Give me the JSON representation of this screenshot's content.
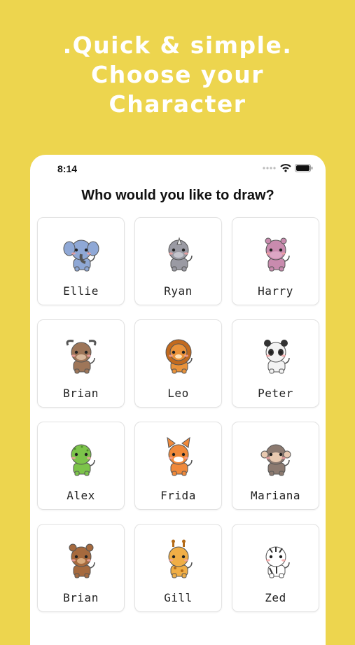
{
  "headline": {
    "line1": ".Quick & simple.",
    "line2": "Choose your",
    "line3": "Character"
  },
  "status_bar": {
    "time": "8:14"
  },
  "prompt": "Who would you like to draw?",
  "characters": [
    {
      "name": "Ellie",
      "animal": "elephant-icon",
      "color": "#8FA8D6"
    },
    {
      "name": "Ryan",
      "animal": "rhino-icon",
      "color": "#9A9AA3"
    },
    {
      "name": "Harry",
      "animal": "hippo-icon",
      "color": "#C98BAE"
    },
    {
      "name": "Brian",
      "animal": "buffalo-icon",
      "color": "#9E7659"
    },
    {
      "name": "Leo",
      "animal": "lion-icon",
      "color": "#E9923A"
    },
    {
      "name": "Peter",
      "animal": "panda-icon",
      "color": "#F3F3F3"
    },
    {
      "name": "Alex",
      "animal": "dinosaur-icon",
      "color": "#7CC44A"
    },
    {
      "name": "Frida",
      "animal": "fox-icon",
      "color": "#F0893A"
    },
    {
      "name": "Mariana",
      "animal": "monkey-icon",
      "color": "#8C7A70"
    },
    {
      "name": "Brian",
      "animal": "bear-icon",
      "color": "#A66A3E"
    },
    {
      "name": "Gill",
      "animal": "giraffe-icon",
      "color": "#F0AE46"
    },
    {
      "name": "Zed",
      "animal": "zebra-icon",
      "color": "#FFFFFF"
    }
  ],
  "colors": {
    "background": "#EDD54E",
    "card_border": "#E2E2E2"
  }
}
